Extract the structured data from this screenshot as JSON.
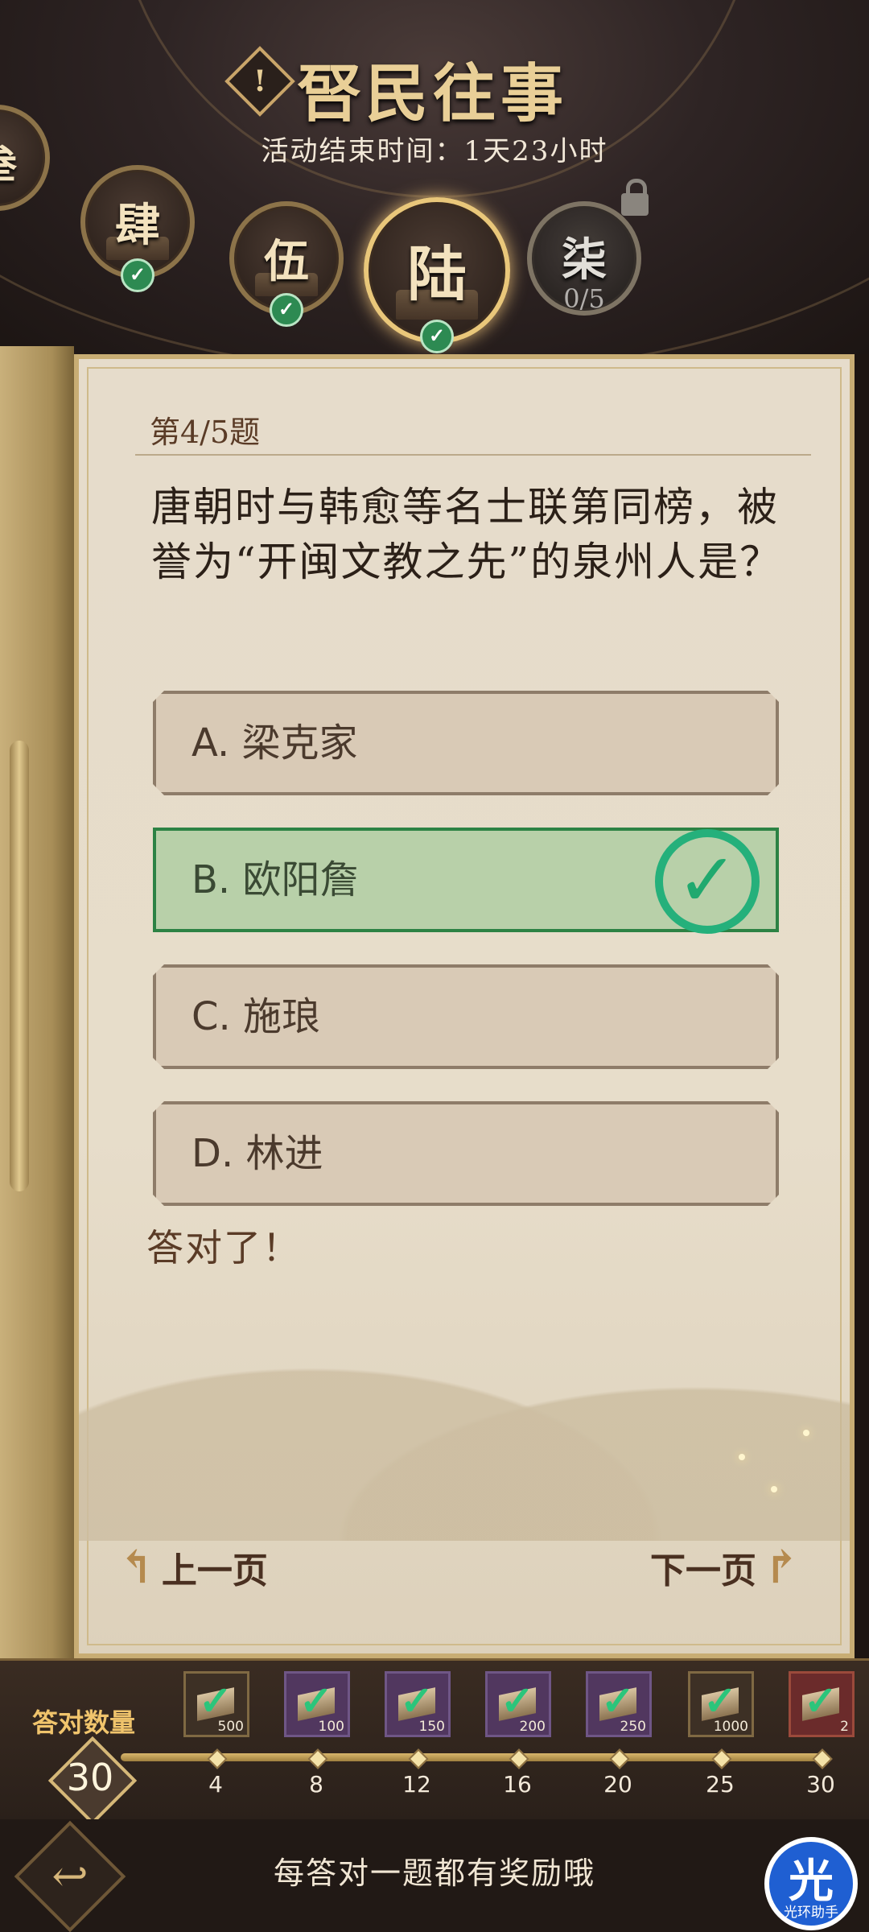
{
  "header": {
    "title": "唘民往事",
    "timer": "活动结束时间：1天23小时",
    "chapters": [
      {
        "label": "叁",
        "state": "done"
      },
      {
        "label": "肆",
        "state": "done"
      },
      {
        "label": "伍",
        "state": "done"
      },
      {
        "label": "陆",
        "state": "active-done"
      },
      {
        "label": "柒",
        "state": "locked",
        "progress": "0/5"
      }
    ]
  },
  "quiz": {
    "question_no": "第4/5题",
    "question": "唐朝时与韩愈等名士联第同榜，被誉为“开闽文教之先”的泉州人是？",
    "options": [
      {
        "text": "A. 梁克家",
        "correct": false
      },
      {
        "text": "B. 欧阳詹",
        "correct": true
      },
      {
        "text": "C. 施琅",
        "correct": false
      },
      {
        "text": "D. 林进",
        "correct": false
      }
    ],
    "feedback": "答对了！",
    "prev": "上一页",
    "next": "下一页"
  },
  "rewards": {
    "count_label": "答对数量",
    "count": "30",
    "chests": [
      {
        "amount": "500",
        "style": "brown"
      },
      {
        "amount": "100",
        "style": "purple"
      },
      {
        "amount": "150",
        "style": "purple"
      },
      {
        "amount": "200",
        "style": "purple"
      },
      {
        "amount": "250",
        "style": "purple"
      },
      {
        "amount": "1000",
        "style": "brown"
      },
      {
        "amount": "2",
        "style": "red"
      }
    ],
    "milestones": [
      "4",
      "8",
      "12",
      "16",
      "20",
      "25",
      "30"
    ]
  },
  "footer": {
    "hint": "每答对一题都有奖励哦",
    "assist_glyph": "光",
    "assist_label": "光环助手"
  },
  "colors": {
    "accent_gold": "#e9cf97",
    "correct_green": "#25b07b"
  }
}
